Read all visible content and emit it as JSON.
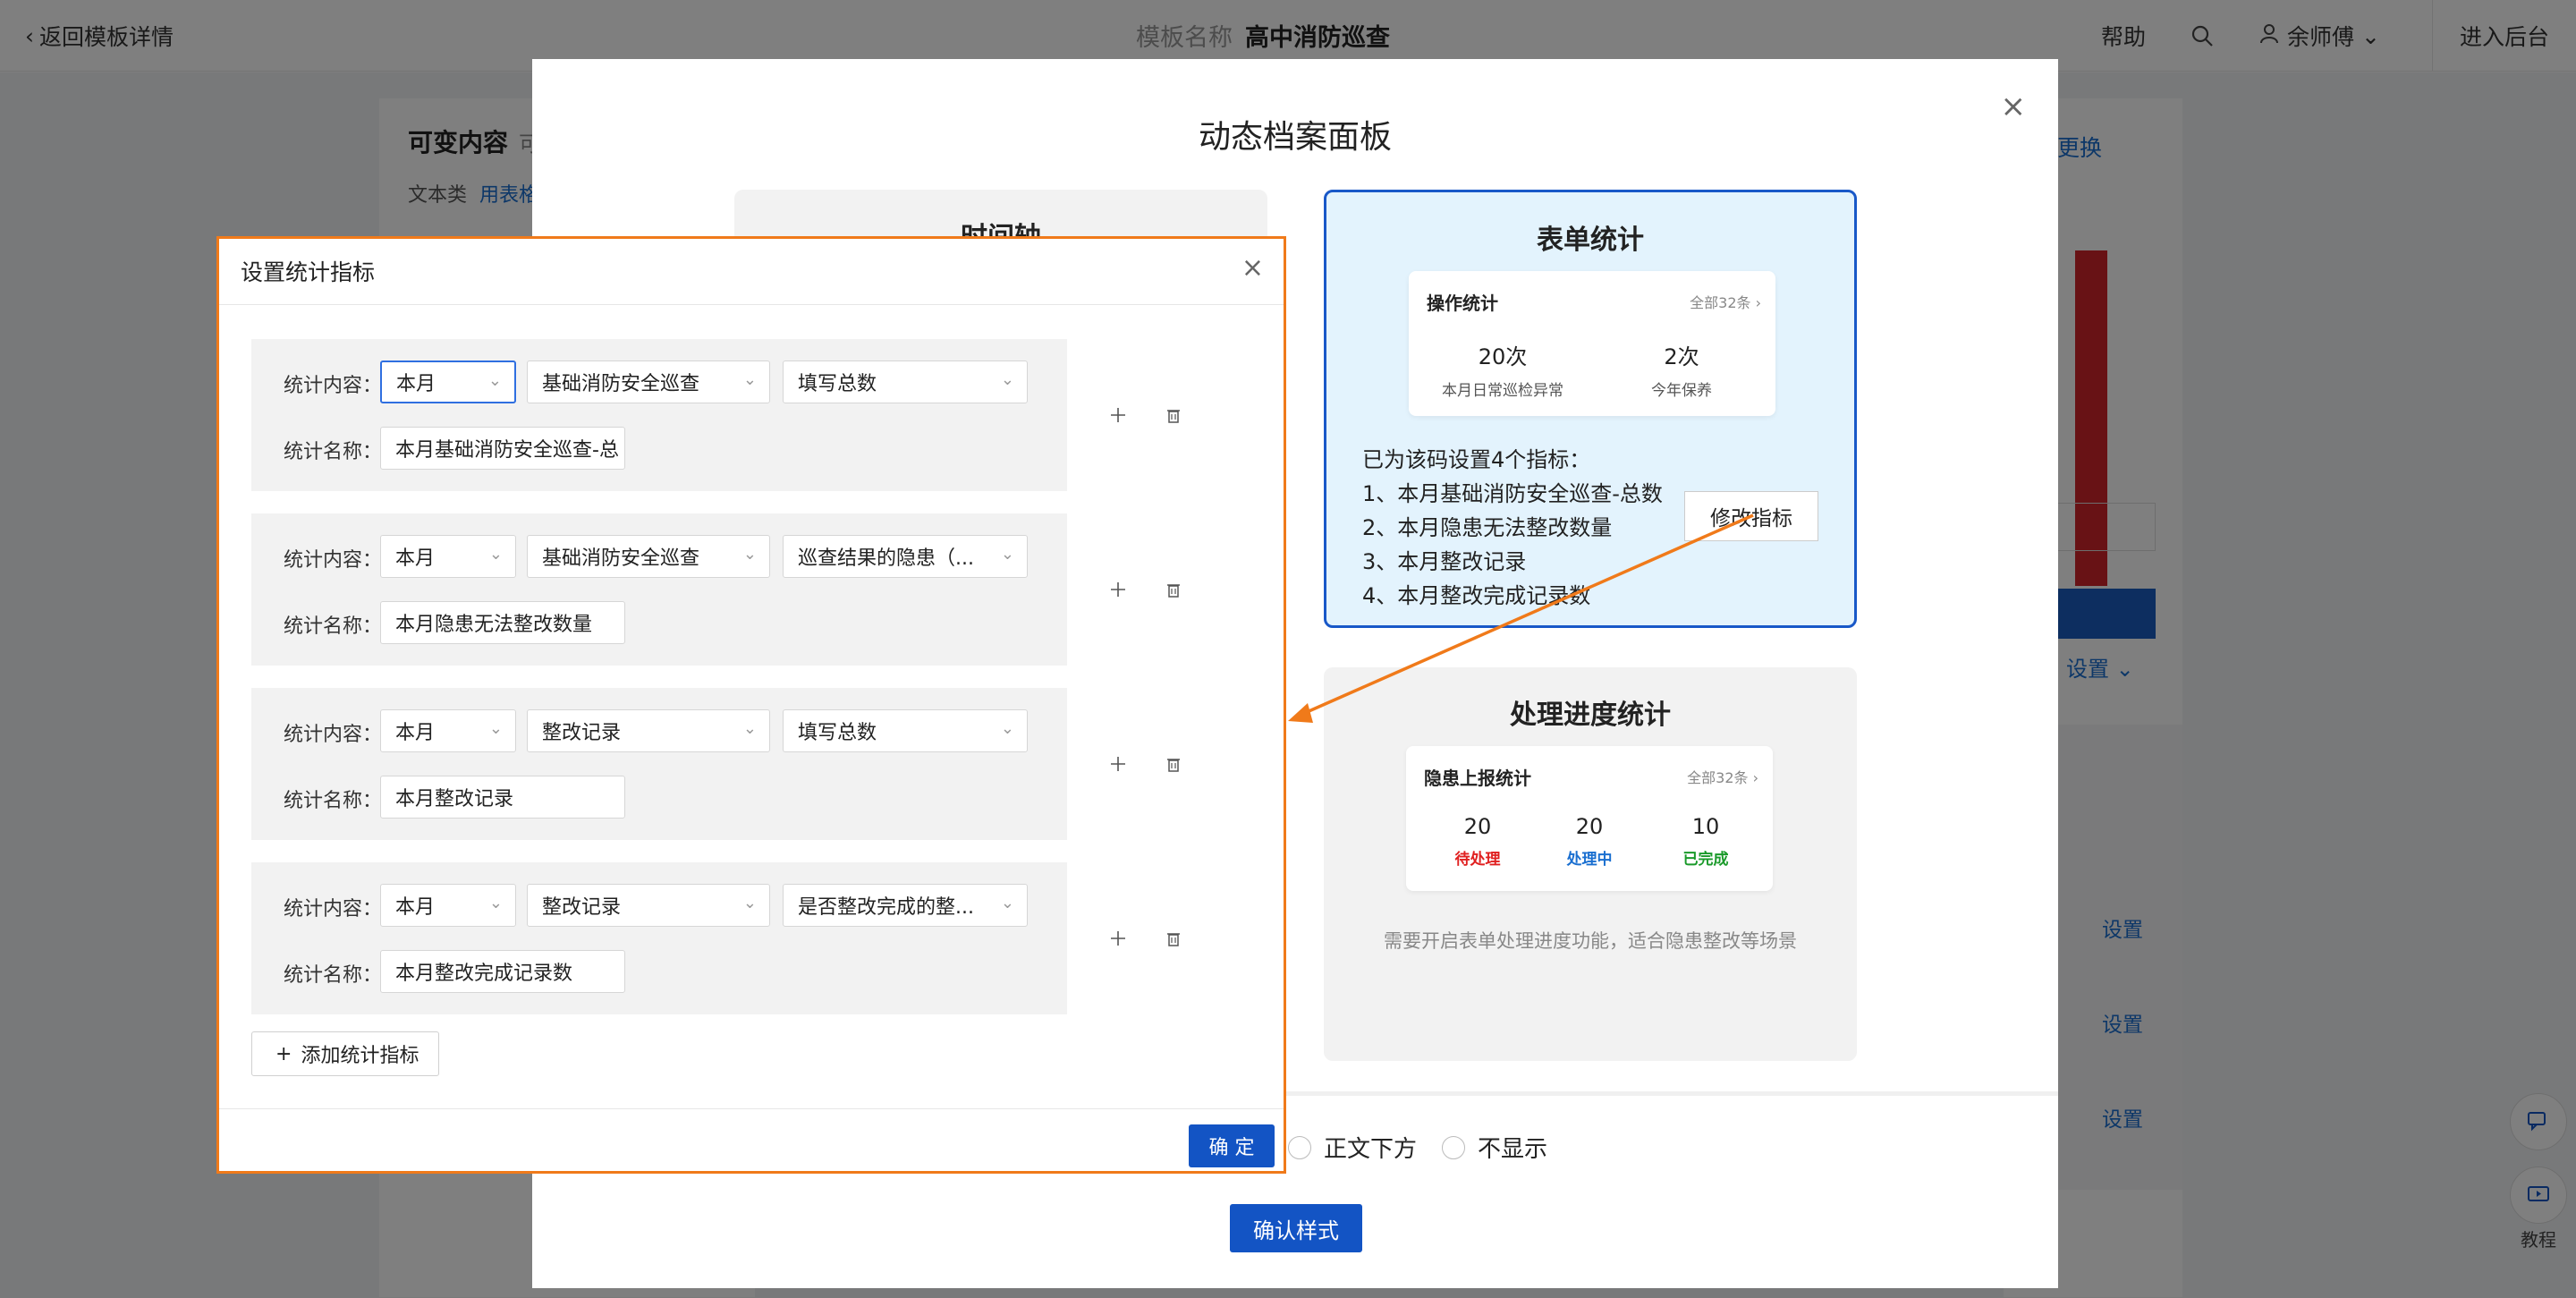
{
  "topbar": {
    "back_label": "返回模板详情",
    "center_prefix": "模板名称",
    "center_title": "高中消防巡查",
    "help_label": "帮助",
    "user_name": "余师傅",
    "backend_label": "进入后台"
  },
  "left_panel": {
    "title": "可变内容",
    "title_hint": "可",
    "sub_label": "文本类",
    "sub_link": "用表格"
  },
  "right_panel": {
    "link_label": "更换",
    "set_label": "设置",
    "setting_labels": [
      "设置",
      "设置",
      "设置"
    ]
  },
  "float_buttons": {
    "tutorial_label": "教程"
  },
  "modal": {
    "title": "动态档案面板",
    "timeline_title": "时间轴",
    "form_card": {
      "title": "表单统计",
      "inner_title": "操作统计",
      "inner_more": "全部32条 ›",
      "stats": [
        {
          "num": "20次",
          "label": "本月日常巡检异常"
        },
        {
          "num": "2次",
          "label": "今年保养"
        }
      ],
      "info_heading": "已为该码设置4个指标：",
      "info_lines": [
        "1、本月基础消防安全巡查-总数",
        "2、本月隐患无法整改数量",
        "3、本月整改记录",
        "4、本月整改完成记录数"
      ],
      "modify_label": "修改指标"
    },
    "progress_card": {
      "title": "处理进度统计",
      "inner_title": "隐患上报统计",
      "inner_more": "全部32条 ›",
      "stats": [
        {
          "num": "20",
          "label": "待处理",
          "color": "#e02020"
        },
        {
          "num": "20",
          "label": "处理中",
          "color": "#1a6fd0"
        },
        {
          "num": "10",
          "label": "已完成",
          "color": "#1a9a2a"
        }
      ],
      "note": "需要开启表单处理进度功能，适合隐患整改等场景"
    },
    "radio_options": [
      "正文下方",
      "不显示"
    ],
    "confirm_label": "确认样式"
  },
  "dialog": {
    "title": "设置统计指标",
    "content_label": "统计内容：",
    "name_label": "统计名称：",
    "rows": [
      {
        "period": "本月",
        "form": "基础消防安全巡查",
        "metric": "填写总数",
        "name": "本月基础消防安全巡查-总"
      },
      {
        "period": "本月",
        "form": "基础消防安全巡查",
        "metric": "巡查结果的隐患（...",
        "name": "本月隐患无法整改数量"
      },
      {
        "period": "本月",
        "form": "整改记录",
        "metric": "填写总数",
        "name": "本月整改记录"
      },
      {
        "period": "本月",
        "form": "整改记录",
        "metric": "是否整改完成的整...",
        "name": "本月整改完成记录数"
      }
    ],
    "add_label": "添加统计指标",
    "ok_label": "确 定"
  },
  "colors": {
    "primary": "#1354c4",
    "highlight_border": "#f07a1a",
    "card_selected_bg": "#e3f3fd"
  }
}
